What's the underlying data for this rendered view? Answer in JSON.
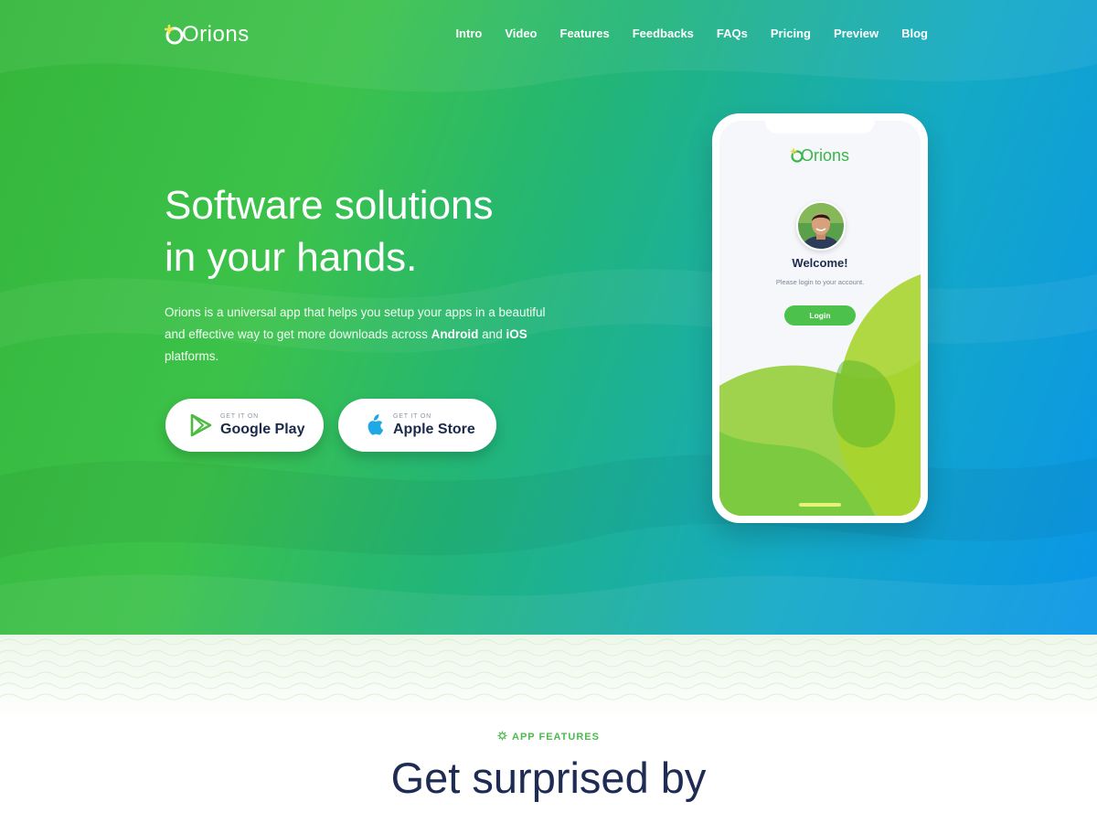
{
  "brand": {
    "name": "Orions",
    "accent": "#3cb54a",
    "dark": "#1e2b52"
  },
  "nav": {
    "items": [
      {
        "label": "Intro"
      },
      {
        "label": "Video"
      },
      {
        "label": "Features"
      },
      {
        "label": "Feedbacks"
      },
      {
        "label": "FAQs"
      },
      {
        "label": "Pricing"
      },
      {
        "label": "Preview"
      },
      {
        "label": "Blog"
      }
    ]
  },
  "hero": {
    "headline_line1": "Software solutions",
    "headline_line2": "in your hands.",
    "desc_part1": "Orions is a universal app that helps you setup your apps in a beautiful and effective way to get more downloads across ",
    "desc_android": "Android",
    "desc_and": " and ",
    "desc_ios": "iOS",
    "desc_end": " platforms.",
    "google_small": "GET IT ON",
    "google_label": "Google Play",
    "apple_small": "GET IT ON",
    "apple_label": "Apple Store"
  },
  "phone": {
    "logo": "Orions",
    "welcome": "Welcome!",
    "hint": "Please login to your account.",
    "login": "Login"
  },
  "features": {
    "eyebrow": "APP FEATURES",
    "title": "Get surprised by"
  },
  "icons": {
    "google_play": "play-store-icon",
    "apple": "apple-icon",
    "eyebrow": "gear-icon"
  }
}
